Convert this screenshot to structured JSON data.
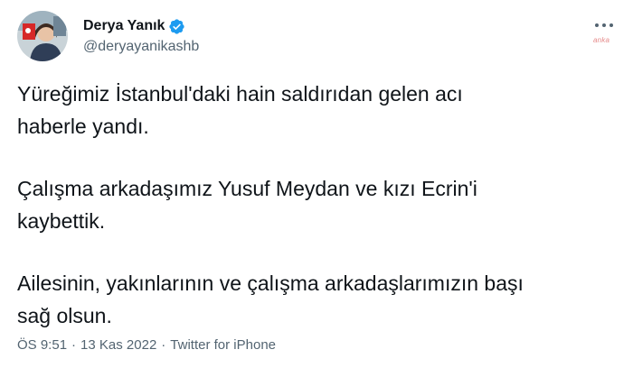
{
  "author": {
    "display_name": "Derya Yanık",
    "handle": "@deryayanikashb",
    "verified": true,
    "avatar_icon": "avatar-photo-icon",
    "verified_icon": "verified-badge-icon"
  },
  "tweet": {
    "paragraphs": [
      "Yüreğimiz İstanbul'daki hain saldırıdan gelen acı\nhaberle yandı.",
      "Çalışma arkadaşımız Yusuf Meydan ve kızı Ecrin'i\nkaybettik.",
      "Ailesinin, yakınlarının ve çalışma arkadaşlarımızın başı\nsağ olsun."
    ]
  },
  "meta": {
    "time": "ÖS 9:51",
    "date": "13 Kas 2022",
    "source": "Twitter for iPhone",
    "separator": "·"
  },
  "watermark": "anka",
  "colors": {
    "text": "#0f1419",
    "secondary": "#536471",
    "verified": "#1d9bf0"
  }
}
